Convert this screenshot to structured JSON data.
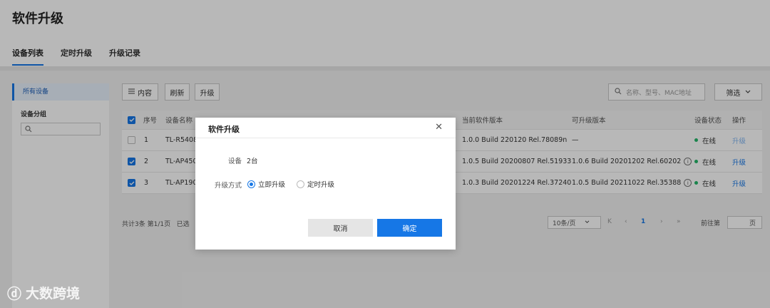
{
  "page": {
    "title": "软件升级"
  },
  "tabs": [
    {
      "label": "设备列表",
      "active": true
    },
    {
      "label": "定时升级",
      "active": false
    },
    {
      "label": "升级记录",
      "active": false
    }
  ],
  "sidebar": {
    "all_devices": "所有设备",
    "group_title": "设备分组",
    "search_icon": "search-icon"
  },
  "toolbar": {
    "content_btn": "内容",
    "refresh_btn": "刷新",
    "upgrade_btn": "升级",
    "search_placeholder": "名称、型号、MAC地址",
    "filter_btn": "筛选"
  },
  "table": {
    "headers": {
      "index": "序号",
      "name": "设备名称",
      "current_version": "当前软件版本",
      "upgradable_version": "可升级版本",
      "status": "设备状态",
      "action": "操作"
    },
    "rows": [
      {
        "checked": false,
        "index": "1",
        "name": "TL-R5408P",
        "current_version": "1.0.0 Build 220120 Rel.78089n",
        "upgradable_version": "—",
        "status": "在线",
        "action": "升级",
        "action_enabled": false
      },
      {
        "checked": true,
        "index": "2",
        "name": "TL-AP450",
        "current_version": "1.0.5 Build 20200807 Rel.51933",
        "upgradable_version": "1.0.6 Build 20201202 Rel.60202",
        "status": "在线",
        "action": "升级",
        "action_enabled": true
      },
      {
        "checked": true,
        "index": "3",
        "name": "TL-AP190",
        "current_version": "1.0.3 Build 20201224 Rel.37240",
        "upgradable_version": "1.0.5 Build 20211022 Rel.35388",
        "status": "在线",
        "action": "升级",
        "action_enabled": true
      }
    ]
  },
  "pager": {
    "summary": "共计3条  第1/1页",
    "selected_prefix": "已选",
    "page_size": "10条/页",
    "current_page": "1",
    "goto_label": "前往第",
    "goto_suffix": "页"
  },
  "modal": {
    "title": "软件升级",
    "device_label": "设备",
    "device_value": "2台",
    "mode_label": "升级方式",
    "option_now": "立即升级",
    "option_scheduled": "定时升级",
    "selected_option": "立即升级",
    "cancel": "取消",
    "ok": "确定"
  },
  "watermark": {
    "text": "大数跨境",
    "logo_text": "ⓓ"
  },
  "colors": {
    "accent": "#1677e6",
    "online": "#25b86a"
  }
}
